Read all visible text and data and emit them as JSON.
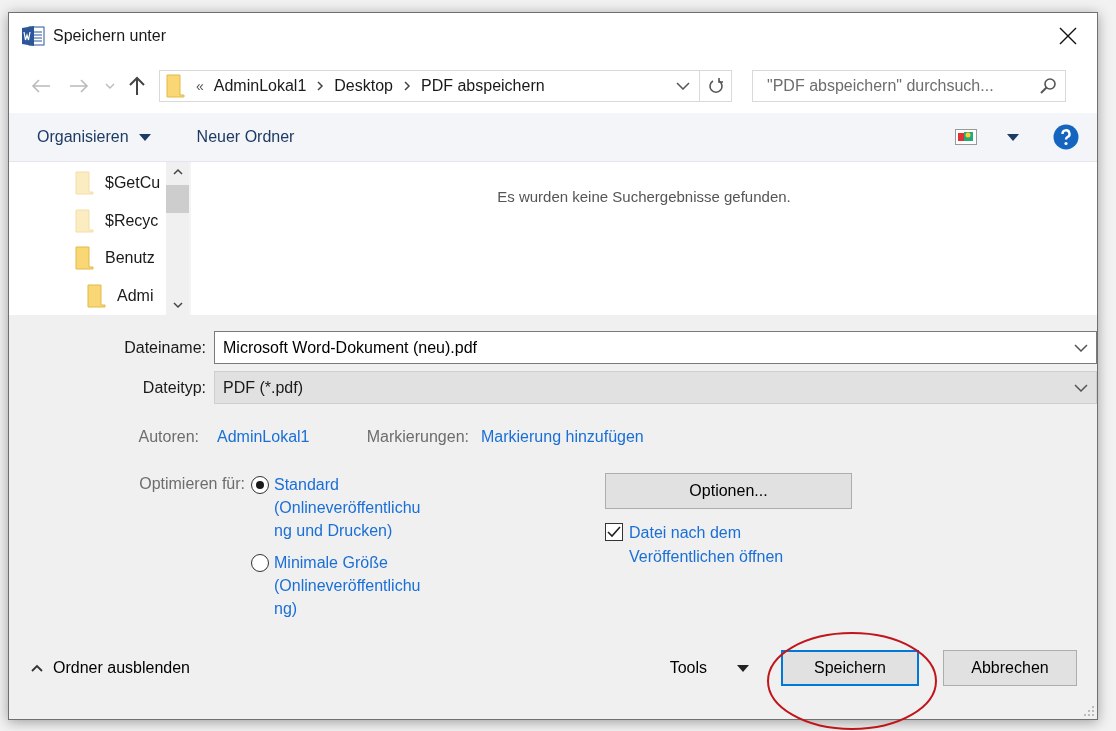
{
  "window": {
    "title": "Speichern unter"
  },
  "address": {
    "prefix": "«",
    "crumbs": [
      "AdminLokal1",
      "Desktop",
      "PDF abspeichern"
    ]
  },
  "search": {
    "placeholder": "\"PDF abspeichern\" durchsuch..."
  },
  "toolbar": {
    "organize": "Organisieren",
    "new_folder": "Neuer Ordner"
  },
  "folders": [
    {
      "name": "$GetCu",
      "dimmed": true
    },
    {
      "name": "$Recyc",
      "dimmed": true
    },
    {
      "name": "Benutz",
      "dimmed": false,
      "children": [
        {
          "name": "Admi",
          "dimmed": false
        }
      ]
    }
  ],
  "empty_message": "Es wurden keine Suchergebnisse gefunden.",
  "fields": [
    {
      "label": "Dateiname:",
      "value": "Microsoft Word-Dokument (neu).pdf",
      "kind": "combo"
    },
    {
      "label": "Dateityp:",
      "value": "PDF (*.pdf)",
      "kind": "select"
    }
  ],
  "metadata": [
    {
      "label": "Autoren:",
      "value": "AdminLokal1"
    },
    {
      "label": "Markierungen:",
      "value": "Markierung hinzufügen"
    }
  ],
  "optimize": {
    "label": "Optimieren für:",
    "options": [
      {
        "label": "Standard (Onlineveröffentlichung und Drucken)",
        "selected": true
      },
      {
        "label": "Minimale Größe (Onlineveröffentlichung)",
        "selected": false
      }
    ]
  },
  "options_button": "Optionen...",
  "open_after": {
    "label": "Datei nach dem Veröffentlichen öffnen",
    "checked": true
  },
  "footer": {
    "hide_folders": "Ordner ausblenden",
    "tools": "Tools",
    "buttons": [
      {
        "label": "Speichern",
        "default": true
      },
      {
        "label": "Abbrechen",
        "default": false
      }
    ]
  }
}
